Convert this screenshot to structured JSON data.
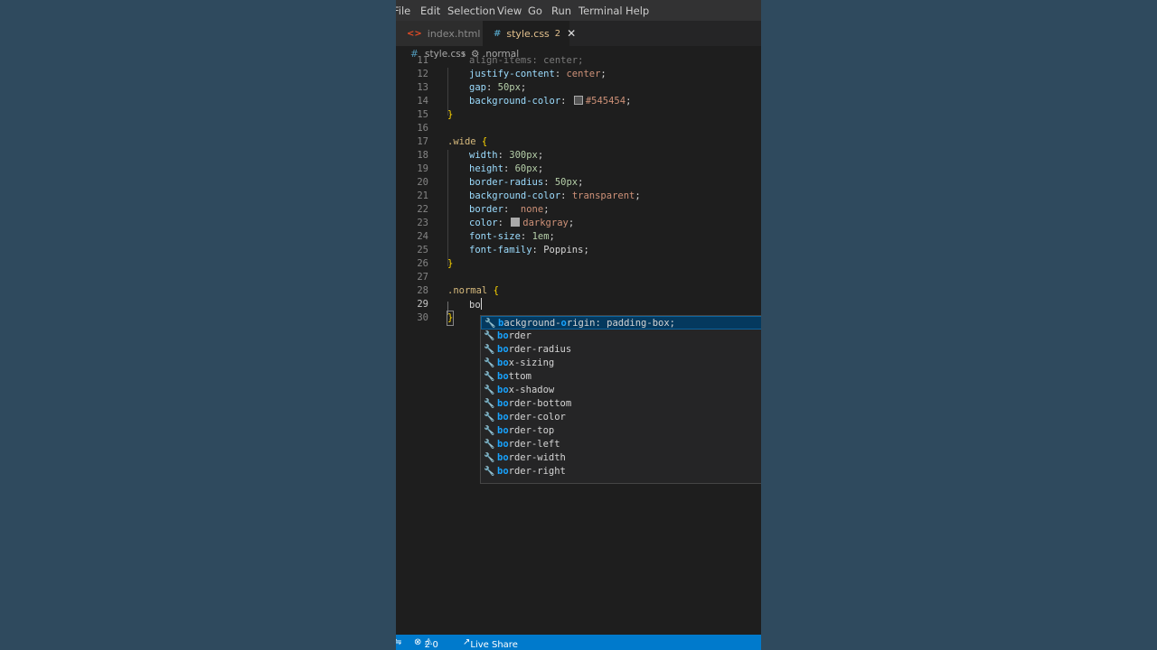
{
  "menu": [
    "File",
    "Edit",
    "Selection",
    "View",
    "Go",
    "Run",
    "Terminal",
    "Help"
  ],
  "tabs": [
    {
      "label": "index.html",
      "icon": "html-file-icon",
      "active": false
    },
    {
      "label": "style.css",
      "badge": "2",
      "icon": "css-file-icon",
      "active": true
    }
  ],
  "breadcrumb": {
    "file": "style.css",
    "symbol": ".normal"
  },
  "code_lines": [
    {
      "n": "11",
      "text": "align-items: center;"
    },
    {
      "n": "12",
      "prop": "justify-content",
      "value": "center"
    },
    {
      "n": "13",
      "prop": "gap",
      "value": "50px"
    },
    {
      "n": "14",
      "prop": "background-color",
      "value": "#545454",
      "swatch": "#545454"
    },
    {
      "n": "15",
      "text": "}"
    },
    {
      "n": "16",
      "text": ""
    },
    {
      "n": "17",
      "selector": ".wide",
      "text": " {"
    },
    {
      "n": "18",
      "prop": "width",
      "value": "300px"
    },
    {
      "n": "19",
      "prop": "height",
      "value": "60px"
    },
    {
      "n": "20",
      "prop": "border-radius",
      "value": "50px"
    },
    {
      "n": "21",
      "prop": "background-color",
      "value": "transparent"
    },
    {
      "n": "22",
      "prop": "border",
      "value": "none"
    },
    {
      "n": "23",
      "prop": "color",
      "value": "darkgray",
      "swatch": "#a9a9a9"
    },
    {
      "n": "24",
      "prop": "font-size",
      "value": "1em"
    },
    {
      "n": "25",
      "prop": "font-family",
      "value": "Poppins"
    },
    {
      "n": "26",
      "text": "}"
    },
    {
      "n": "27",
      "text": ""
    },
    {
      "n": "28",
      "selector": ".normal",
      "text": " {"
    },
    {
      "n": "29",
      "typed": "bo"
    },
    {
      "n": "30",
      "text": "}"
    }
  ],
  "suggestions": [
    {
      "match": "b",
      "rest": "ackground-",
      "match2": "o",
      "rest2": "rigin: padding-box;"
    },
    {
      "match": "bo",
      "rest": "rder"
    },
    {
      "match": "bo",
      "rest": "rder-radius"
    },
    {
      "match": "bo",
      "rest": "x-sizing"
    },
    {
      "match": "bo",
      "rest": "ttom"
    },
    {
      "match": "bo",
      "rest": "x-shadow"
    },
    {
      "match": "bo",
      "rest": "rder-bottom"
    },
    {
      "match": "bo",
      "rest": "rder-color"
    },
    {
      "match": "bo",
      "rest": "rder-top"
    },
    {
      "match": "bo",
      "rest": "rder-left"
    },
    {
      "match": "bo",
      "rest": "rder-width"
    },
    {
      "match": "bo",
      "rest": "rder-right"
    }
  ],
  "status": {
    "errors": "2",
    "warnings": "0",
    "live_share": "Live Share"
  },
  "colors": {
    "status_bar": "#007acc",
    "page_bg": "#2f4a5e",
    "editor_bg": "#1e1e1e"
  }
}
